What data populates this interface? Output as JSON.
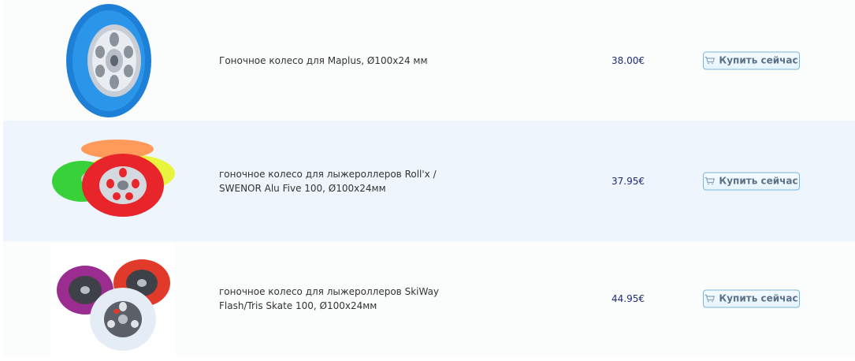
{
  "products": [
    {
      "name": "Гоночное колесо для Maplus, Ø100x24 мм",
      "price": "38.00€",
      "buy_label": "Купить сейчас",
      "image": "blue-wheel"
    },
    {
      "name": "гоночное колесо для лыжероллеров Roll'x / SWENOR Alu Five 100, Ø100x24мм",
      "price": "37.95€",
      "buy_label": "Купить сейчас",
      "image": "colored-wheels-stack"
    },
    {
      "name": "гоночное колесо для лыжероллеров SkiWay Flash/Tris Skate 100, Ø100x24мм",
      "price": "44.95€",
      "buy_label": "Купить сейчас",
      "image": "skiway-wheels"
    }
  ],
  "colors": {
    "price": "#1e2a78",
    "button_border": "#79b6dc",
    "alt_row": "#eef5fc"
  },
  "icons": {
    "buy": "cart-icon"
  }
}
